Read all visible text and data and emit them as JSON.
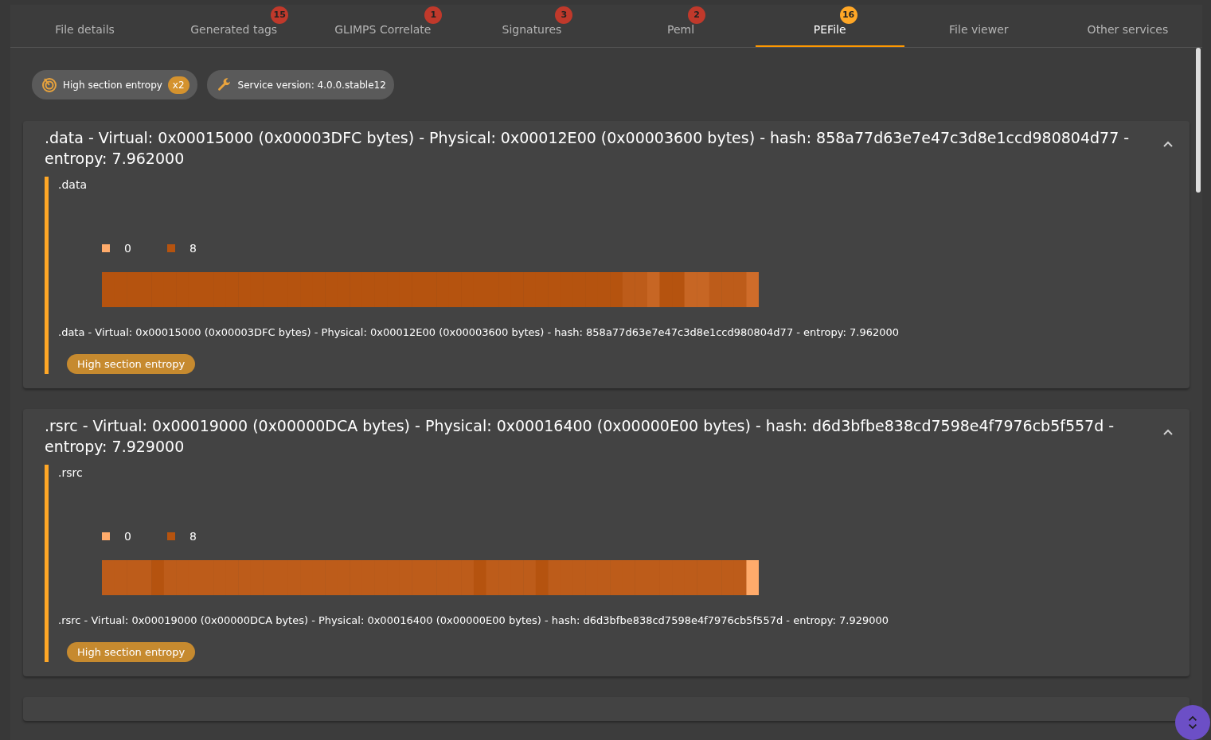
{
  "tabs": [
    {
      "label": "File details",
      "selected": false
    },
    {
      "label": "Generated tags",
      "selected": false,
      "badge": {
        "count": "15",
        "color": "#c0392b"
      }
    },
    {
      "label": "GLIMPS Correlate",
      "selected": false,
      "badge": {
        "count": "1",
        "color": "#c0392b"
      }
    },
    {
      "label": "Signatures",
      "selected": false,
      "badge": {
        "count": "3",
        "color": "#c0392b"
      }
    },
    {
      "label": "Peml",
      "selected": false,
      "badge": {
        "count": "2",
        "color": "#c0392b"
      }
    },
    {
      "label": "PEFile",
      "selected": true,
      "badge": {
        "count": "16",
        "color": "#ffa726"
      }
    },
    {
      "label": "File viewer",
      "selected": false
    },
    {
      "label": "Other services",
      "selected": false
    }
  ],
  "chips": [
    {
      "kind": "heuristic",
      "label": "High section entropy",
      "count": "x2"
    },
    {
      "kind": "version",
      "label": "Service version: 4.0.0.stable12"
    }
  ],
  "sections": [
    {
      "title": ".data - Virtual: 0x00015000 (0x00003DFC bytes) - Physical: 0x00012E00 (0x00003600 bytes) - hash: 858a77d63e7e47c3d8e1ccd980804d77 - entropy: 7.962000",
      "expanded": true,
      "name": ".data",
      "legend": [
        "0",
        "8"
      ],
      "body": ".data - Virtual: 0x00015000 (0x00003DFC bytes) - Physical: 0x00012E00 (0x00003600 bytes) - hash: 858a77d63e7e47c3d8e1ccd980804d77 - entropy: 7.962000",
      "tag": "High section entropy"
    },
    {
      "title": ".rsrc - Virtual: 0x00019000 (0x00000DCA bytes) - Physical: 0x00016400 (0x00000E00 bytes) - hash: d6d3bfbe838cd7598e4f7976cb5f557d - entropy: 7.929000",
      "expanded": true,
      "name": ".rsrc",
      "legend": [
        "0",
        "8"
      ],
      "body": ".rsrc - Virtual: 0x00019000 (0x00000DCA bytes) - Physical: 0x00016400 (0x00000E00 bytes) - hash: d6d3bfbe838cd7598e4f7976cb5f557d - entropy: 7.929000",
      "tag": "High section entropy"
    }
  ]
}
